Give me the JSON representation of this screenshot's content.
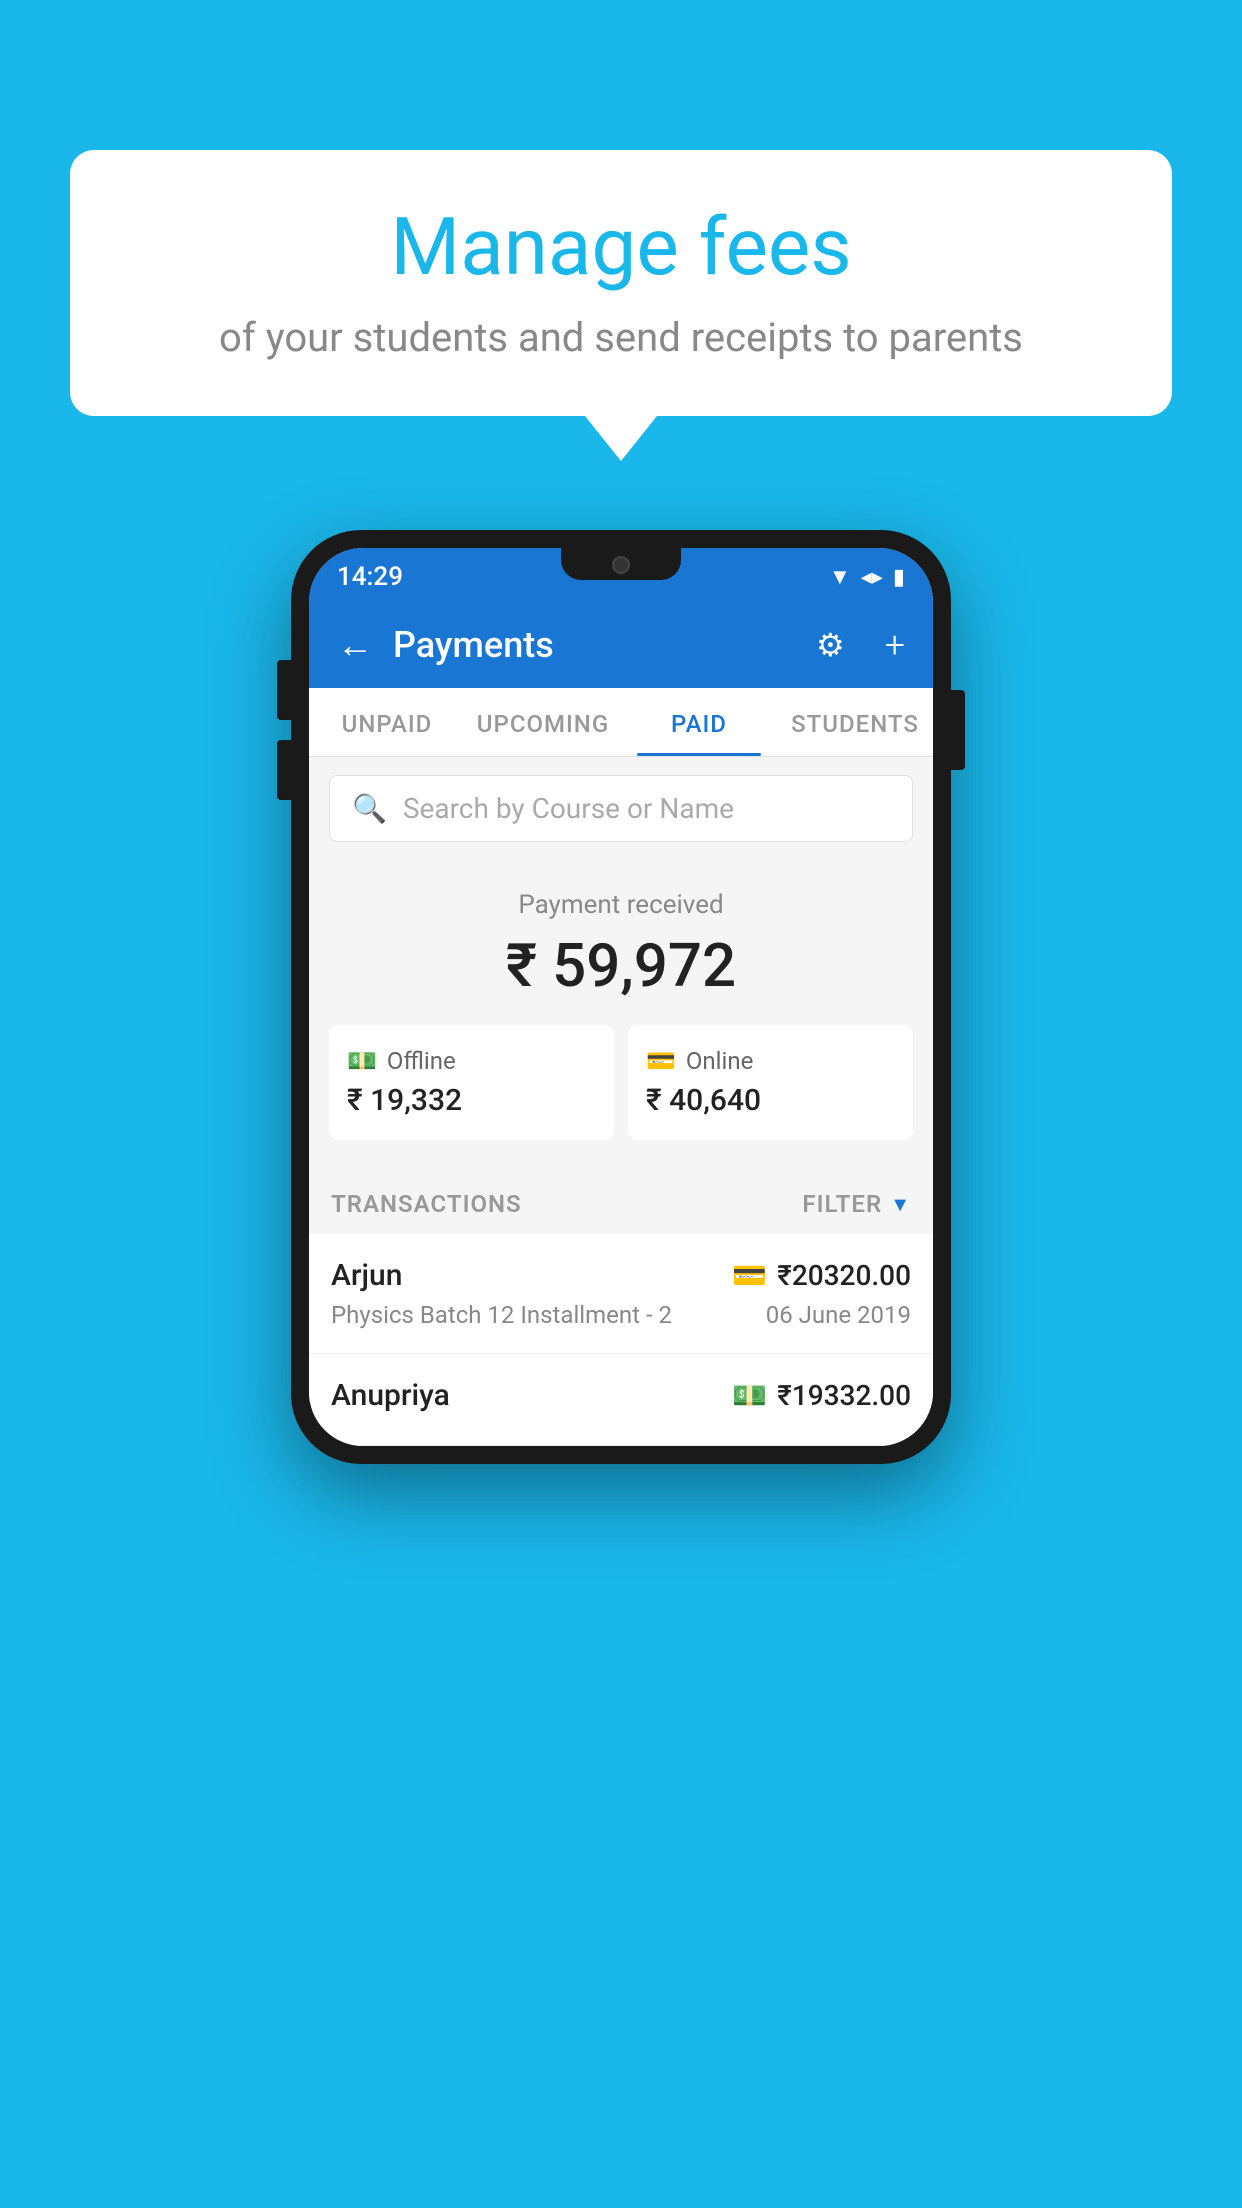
{
  "background_color": "#1ab7ea",
  "bubble": {
    "title": "Manage fees",
    "subtitle": "of your students and send receipts to parents"
  },
  "status_bar": {
    "time": "14:29",
    "icons": [
      "wifi",
      "signal",
      "battery"
    ]
  },
  "header": {
    "title": "Payments",
    "back_label": "←",
    "gear_label": "⚙",
    "plus_label": "+"
  },
  "tabs": [
    {
      "label": "UNPAID",
      "active": false
    },
    {
      "label": "UPCOMING",
      "active": false
    },
    {
      "label": "PAID",
      "active": true
    },
    {
      "label": "STUDENTS",
      "active": false
    }
  ],
  "search": {
    "placeholder": "Search by Course or Name"
  },
  "payment_summary": {
    "label": "Payment received",
    "total": "₹ 59,972",
    "offline": {
      "label": "Offline",
      "amount": "₹ 19,332"
    },
    "online": {
      "label": "Online",
      "amount": "₹ 40,640"
    }
  },
  "transactions": {
    "section_label": "TRANSACTIONS",
    "filter_label": "FILTER",
    "rows": [
      {
        "name": "Arjun",
        "amount": "₹20320.00",
        "course": "Physics Batch 12 Installment - 2",
        "date": "06 June 2019",
        "mode": "card"
      },
      {
        "name": "Anupriya",
        "amount": "₹19332.00",
        "course": "",
        "date": "",
        "mode": "cash"
      }
    ]
  }
}
